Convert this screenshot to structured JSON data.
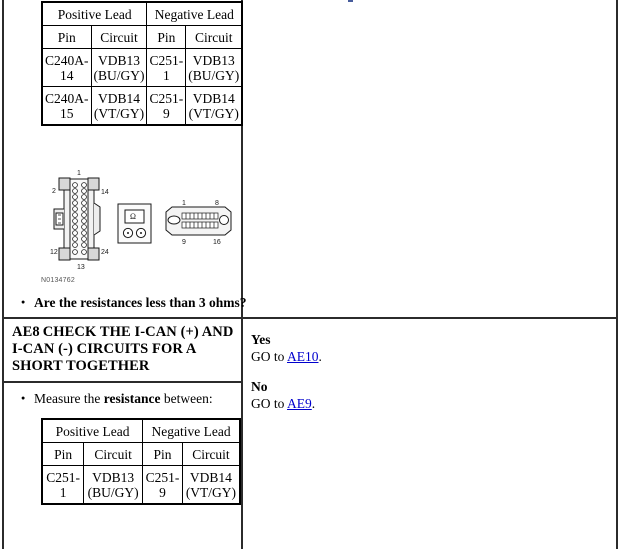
{
  "document": {
    "type": "diagnostic-pinpoint-test",
    "figure_id": "N0134762"
  },
  "step_top": {
    "lead_table": {
      "group_headers": [
        "Positive Lead",
        "Negative Lead"
      ],
      "column_headers": [
        "Pin",
        "Circuit",
        "Pin",
        "Circuit"
      ],
      "rows": [
        [
          "C240A-14",
          "VDB13 (BU/GY)",
          "C251-1",
          "VDB13 (BU/GY)"
        ],
        [
          "C240A-15",
          "VDB14 (VT/GY)",
          "C251-9",
          "VDB14 (VT/GY)"
        ]
      ]
    },
    "question": "Are the resistances less than 3 ohms?"
  },
  "figure": {
    "connector_24pin": {
      "name": "24-pin-connector",
      "pin_labels": [
        "1",
        "2",
        "14",
        "12",
        "24",
        "13"
      ],
      "pin_count": 24
    },
    "meter": {
      "name": "ohmmeter",
      "display_symbol": "Ω",
      "terminals": 2
    },
    "connector_16pin": {
      "name": "16-pin-connector",
      "pin_labels": [
        "1",
        "8",
        "9",
        "16"
      ],
      "pin_count": 16
    }
  },
  "step_ae8": {
    "code": "AE8",
    "title": "CHECK THE I-CAN (+) AND I-CAN (-) CIRCUITS FOR A SHORT TOGETHER",
    "instruction_prefix": "Measure the ",
    "instruction_bold": "resistance",
    "instruction_suffix": " between:",
    "lead_table": {
      "group_headers": [
        "Positive Lead",
        "Negative Lead"
      ],
      "column_headers": [
        "Pin",
        "Circuit",
        "Pin",
        "Circuit"
      ],
      "rows": [
        [
          "C251-1",
          "VDB13 (BU/GY)",
          "C251-9",
          "VDB14 (VT/GY)"
        ]
      ]
    },
    "results": {
      "yes_label": "Yes",
      "yes_text_prefix": "GO to ",
      "yes_link": "AE10",
      "yes_text_suffix": ".",
      "no_label": "No",
      "no_text_prefix": "GO to ",
      "no_link": "AE9",
      "no_text_suffix": "."
    }
  },
  "colors": {
    "link": "#0000cd",
    "border": "#2b2b2b",
    "text": "#000000"
  }
}
